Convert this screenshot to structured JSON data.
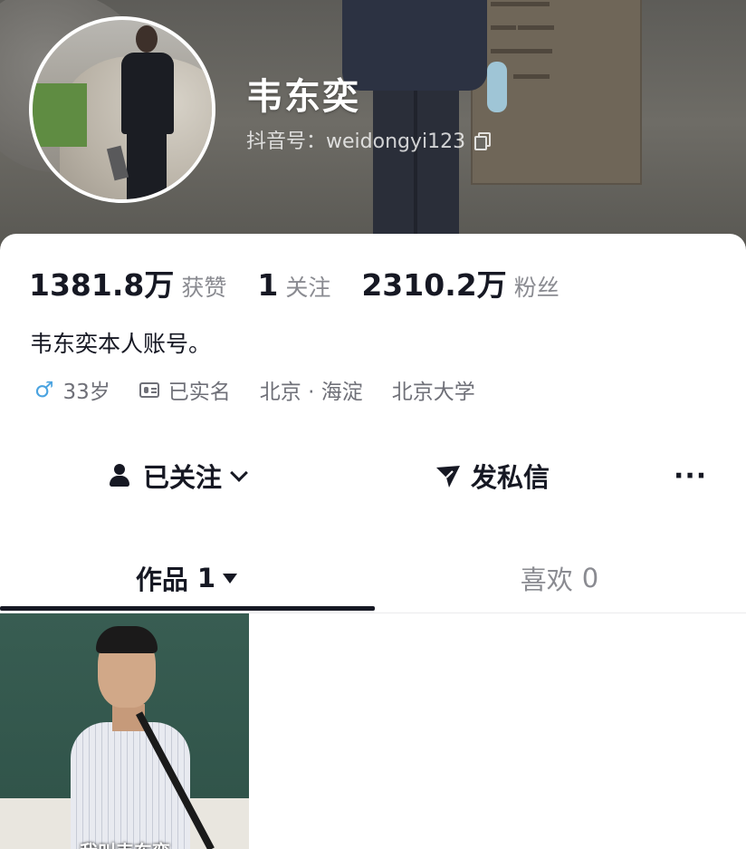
{
  "profile": {
    "name": "韦东奕",
    "handle": "抖音号：weidongyi123"
  },
  "stats": [
    {
      "value": "1381.8万",
      "label": "获赞"
    },
    {
      "value": "1",
      "label": "关注"
    },
    {
      "value": "2310.2万",
      "label": "粉丝"
    }
  ],
  "bio": "韦东奕本人账号。",
  "tags": {
    "age": "33岁",
    "verified": "已实名",
    "location": "北京 · 海淀",
    "school": "北京大学"
  },
  "actions": {
    "follow_label": "已关注",
    "message_label": "发私信",
    "more_label": "···"
  },
  "tabs": {
    "works_label": "作品",
    "works_count": "1",
    "likes_label": "喜欢",
    "likes_count": "0"
  },
  "video": {
    "caption": "我叫韦东奕"
  },
  "colors": {
    "text_primary": "#161823",
    "text_secondary": "#8a8b91",
    "male_icon": "#4aa3e0"
  },
  "icons": [
    "copy-icon",
    "male-icon",
    "id-card-icon",
    "follow-user-icon",
    "chevron-down-icon",
    "send-icon",
    "more-icon",
    "triangle-down-icon"
  ]
}
